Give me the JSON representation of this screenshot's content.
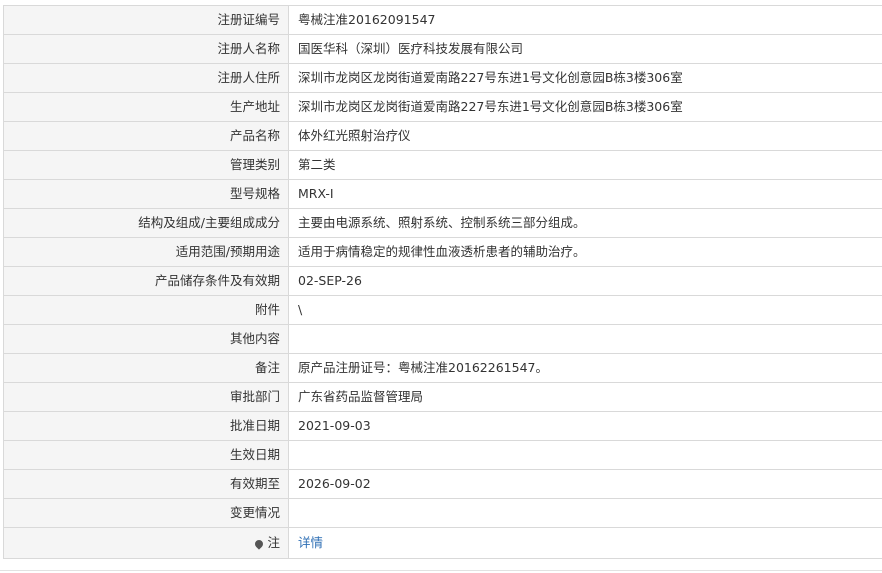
{
  "rows": [
    {
      "label": "注册证编号",
      "value": "粤械注准20162091547"
    },
    {
      "label": "注册人名称",
      "value": "国医华科（深圳）医疗科技发展有限公司"
    },
    {
      "label": "注册人住所",
      "value": "深圳市龙岗区龙岗街道爱南路227号东进1号文化创意园B栋3楼306室"
    },
    {
      "label": "生产地址",
      "value": "深圳市龙岗区龙岗街道爱南路227号东进1号文化创意园B栋3楼306室"
    },
    {
      "label": "产品名称",
      "value": "体外红光照射治疗仪"
    },
    {
      "label": "管理类别",
      "value": "第二类"
    },
    {
      "label": "型号规格",
      "value": "MRX-I"
    },
    {
      "label": "结构及组成/主要组成成分",
      "value": "主要由电源系统、照射系统、控制系统三部分组成。"
    },
    {
      "label": "适用范围/预期用途",
      "value": "适用于病情稳定的规律性血液透析患者的辅助治疗。"
    },
    {
      "label": "产品储存条件及有效期",
      "value": "02-SEP-26"
    },
    {
      "label": "附件",
      "value": "\\"
    },
    {
      "label": "其他内容",
      "value": ""
    },
    {
      "label": "备注",
      "value": "原产品注册证号：粤械注准20162261547。"
    },
    {
      "label": "审批部门",
      "value": "广东省药品监督管理局"
    },
    {
      "label": "批准日期",
      "value": "2021-09-03"
    },
    {
      "label": "生效日期",
      "value": ""
    },
    {
      "label": "有效期至",
      "value": "2026-09-02"
    },
    {
      "label": "变更情况",
      "value": ""
    }
  ],
  "note_row": {
    "label": "注",
    "icon": "pin-icon",
    "link_text": "详情"
  }
}
